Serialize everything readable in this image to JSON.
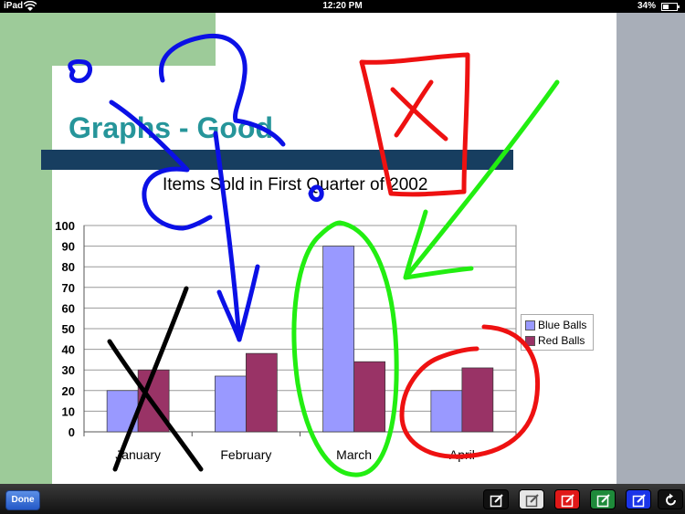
{
  "status_bar": {
    "device": "iPad",
    "time": "12:20 PM",
    "battery": "34%"
  },
  "slide": {
    "title": "Graphs - Good",
    "chart_title": "Items Sold in First Quarter of 2002"
  },
  "chart_data": {
    "type": "bar",
    "title": "Items Sold in First Quarter of 2002",
    "categories": [
      "January",
      "February",
      "March",
      "April"
    ],
    "series": [
      {
        "name": "Blue Balls",
        "values": [
          20,
          27,
          90,
          20
        ],
        "color": "#9999ff"
      },
      {
        "name": "Red Balls",
        "values": [
          30,
          38,
          34,
          31
        ],
        "color": "#993366"
      }
    ],
    "ylim": [
      0,
      100
    ],
    "yticks": [
      "0",
      "10",
      "20",
      "30",
      "40",
      "50",
      "60",
      "70",
      "80",
      "90",
      "100"
    ],
    "grid": true,
    "legend": "right"
  },
  "annotations": {
    "colors": {
      "blue": "#0b10e6",
      "red": "#ee1111",
      "green": "#22ee11",
      "black": "#000000"
    }
  },
  "toolbar": {
    "done_label": "Done",
    "tools": [
      {
        "name": "pen-black",
        "color": "#111111"
      },
      {
        "name": "pen-white",
        "color": "#e6e6e6"
      },
      {
        "name": "pen-red",
        "color": "#e01818"
      },
      {
        "name": "pen-green",
        "color": "#1e8a3a"
      },
      {
        "name": "pen-blue",
        "color": "#1a34e8"
      },
      {
        "name": "undo",
        "color": "#111111"
      }
    ]
  }
}
